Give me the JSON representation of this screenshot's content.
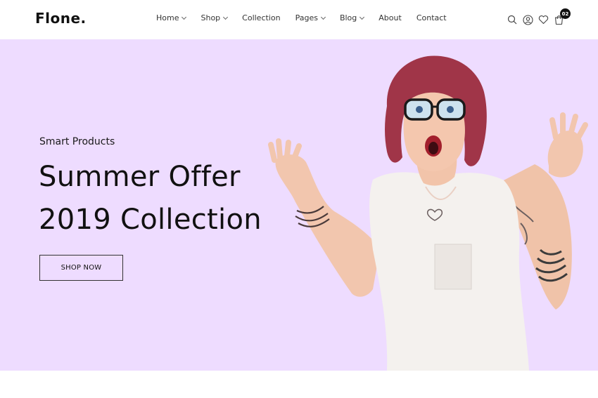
{
  "brand": {
    "logo_text": "Flone."
  },
  "nav": {
    "items": [
      {
        "label": "Home",
        "has_dropdown": true
      },
      {
        "label": "Shop",
        "has_dropdown": true
      },
      {
        "label": "Collection",
        "has_dropdown": false
      },
      {
        "label": "Pages",
        "has_dropdown": true
      },
      {
        "label": "Blog",
        "has_dropdown": true
      },
      {
        "label": "About",
        "has_dropdown": false
      },
      {
        "label": "Contact",
        "has_dropdown": false
      }
    ]
  },
  "header_icons": {
    "search": "search-icon",
    "account": "user-icon",
    "wishlist": "heart-icon",
    "cart": "cart-icon",
    "cart_count": "02"
  },
  "hero": {
    "subtitle": "Smart Products",
    "headline_line1": "Summer Offer",
    "headline_line2": "2019 Collection",
    "cta_label": "SHOP NOW",
    "background_color": "#eedcff"
  }
}
